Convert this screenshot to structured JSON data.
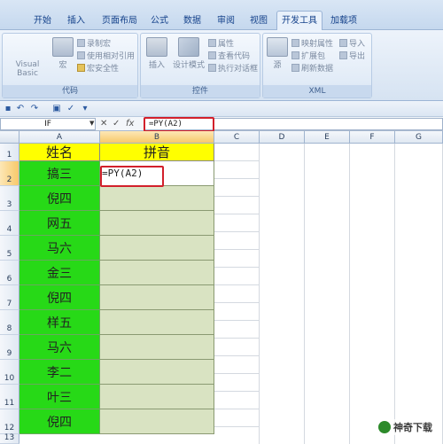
{
  "ribbon_tabs": [
    "开始",
    "插入",
    "页面布局",
    "公式",
    "数据",
    "审阅",
    "视图",
    "开发工具",
    "加载项"
  ],
  "active_tab": "开发工具",
  "groups": {
    "code": {
      "label": "代码",
      "visual_basic": "Visual Basic",
      "macro": "宏",
      "record_macro": "录制宏",
      "relative_ref": "使用相对引用",
      "macro_security": "宏安全性"
    },
    "controls": {
      "label": "控件",
      "insert": "插入",
      "design_mode": "设计模式",
      "properties": "属性",
      "view_code": "查看代码",
      "run_dialog": "执行对话框"
    },
    "xml": {
      "label": "XML",
      "source": "源",
      "map_properties": "映射属性",
      "expansion_packs": "扩展包",
      "refresh_data": "刷新数据",
      "import": "导入",
      "export": "导出"
    }
  },
  "formula_bar": {
    "name_box": "IF",
    "cancel": "✕",
    "enter": "✓",
    "fx": "fx",
    "formula": "=PY(A2)"
  },
  "columns": [
    "A",
    "B",
    "C",
    "D",
    "E",
    "F",
    "G"
  ],
  "rows": [
    "1",
    "2",
    "3",
    "4",
    "5",
    "6",
    "7",
    "8",
    "9",
    "10",
    "11",
    "12",
    "13"
  ],
  "header_row": {
    "a": "姓名",
    "b": "拼音"
  },
  "names": [
    "搞三",
    "倪四",
    "网五",
    "马六",
    "金三",
    "倪四",
    "样五",
    "马六",
    "李二",
    "叶三",
    "倪四"
  ],
  "active_cell_text": "=PY(A2)",
  "watermark": "神奇下载",
  "colors": {
    "name_fill": "#27d917",
    "header_fill": "#ffff00",
    "pinyin_fill": "#d9e3c2",
    "highlight_border": "#d2202b"
  }
}
